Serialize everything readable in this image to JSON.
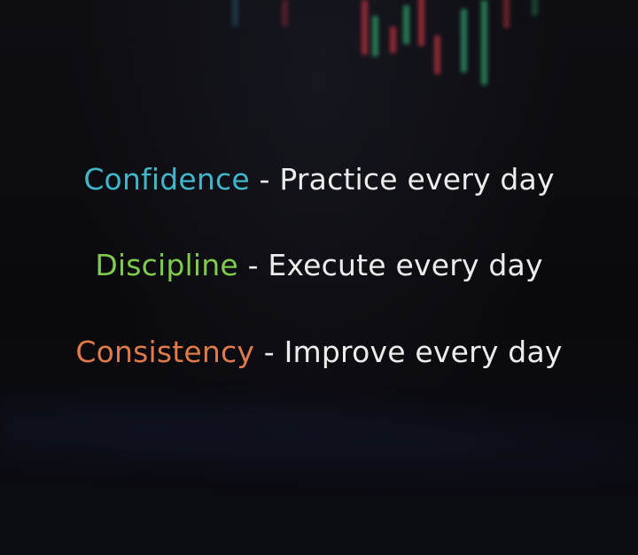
{
  "lines": [
    {
      "keyword": "Confidence",
      "separator": " - ",
      "text": "Practice every day",
      "keyword_color": "#3fb7c9"
    },
    {
      "keyword": "Discipline",
      "separator": " - ",
      "text": "Execute every day",
      "keyword_color": "#7fcb4e"
    },
    {
      "keyword": "Consistency",
      "separator": " - ",
      "text": "Improve every day",
      "keyword_color": "#e07a4a"
    }
  ],
  "colors": {
    "background": "#0b0b0f",
    "body_text": "#ececec",
    "candle_red": "#b8323f",
    "candle_green": "#2f9a6a"
  },
  "background_icon": "blurred-candlestick-chart"
}
